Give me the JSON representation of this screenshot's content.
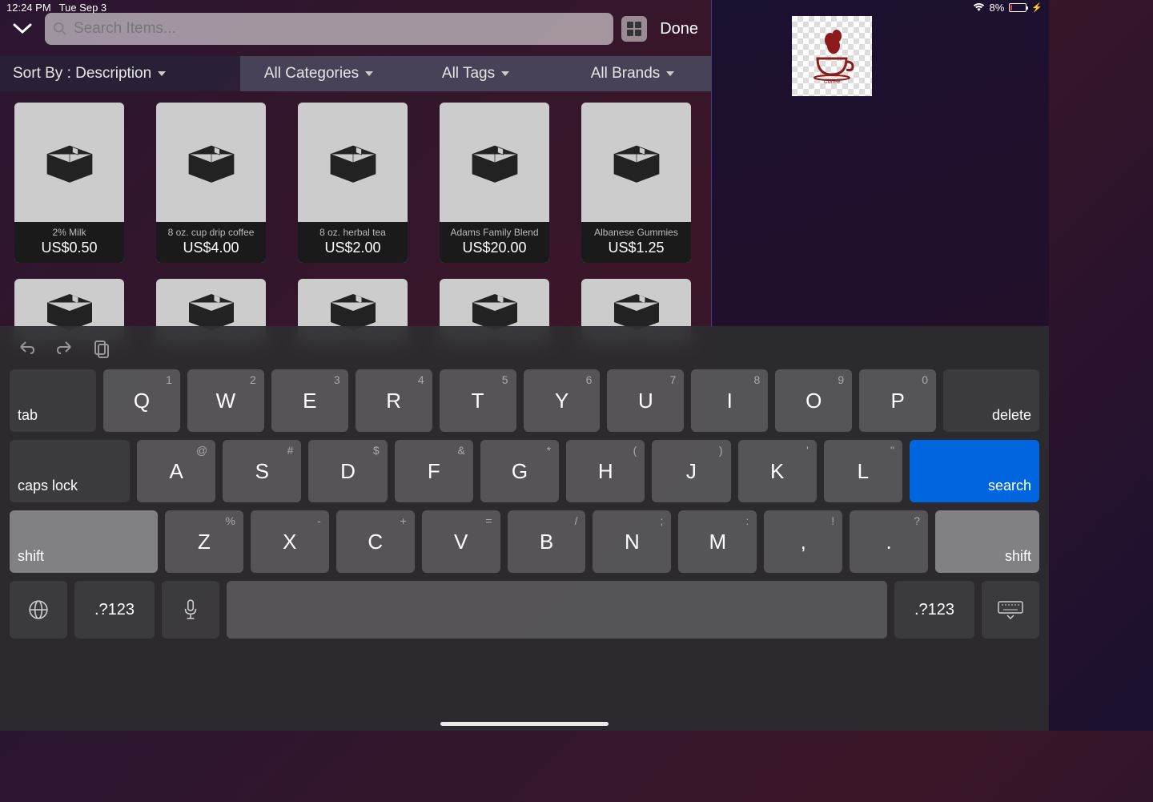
{
  "status": {
    "time": "12:24 PM",
    "date": "Tue Sep 3",
    "battery_pct": "8%"
  },
  "toolbar": {
    "search_placeholder": "Search Items...",
    "done_label": "Done"
  },
  "filters": {
    "sort_label": "Sort By : Description",
    "categories_label": "All Categories",
    "tags_label": "All Tags",
    "brands_label": "All Brands"
  },
  "products": [
    {
      "name": "2% Milk",
      "price": "US$0.50"
    },
    {
      "name": "8 oz. cup drip coffee",
      "price": "US$4.00"
    },
    {
      "name": "8 oz. herbal tea",
      "price": "US$2.00"
    },
    {
      "name": "Adams Family Blend",
      "price": "US$20.00"
    },
    {
      "name": "Albanese Gummies",
      "price": "US$1.25"
    }
  ],
  "logo": {
    "text": "Coffee"
  },
  "keyboard": {
    "row1_subs": [
      "1",
      "2",
      "3",
      "4",
      "5",
      "6",
      "7",
      "8",
      "9",
      "0"
    ],
    "row1": [
      "Q",
      "W",
      "E",
      "R",
      "T",
      "Y",
      "U",
      "I",
      "O",
      "P"
    ],
    "row2_subs": [
      "@",
      "#",
      "$",
      "&",
      "*",
      "(",
      ")",
      "'",
      "\""
    ],
    "row2": [
      "A",
      "S",
      "D",
      "F",
      "G",
      "H",
      "J",
      "K",
      "L"
    ],
    "row3_subs": [
      "%",
      "-",
      "+",
      "=",
      "/",
      ";",
      ":",
      "!",
      "?"
    ],
    "row3": [
      "Z",
      "X",
      "C",
      "V",
      "B",
      "N",
      "M",
      ",",
      "."
    ],
    "tab": "tab",
    "delete": "delete",
    "caps": "caps lock",
    "search": "search",
    "shift": "shift",
    "numkey": ".?123"
  }
}
